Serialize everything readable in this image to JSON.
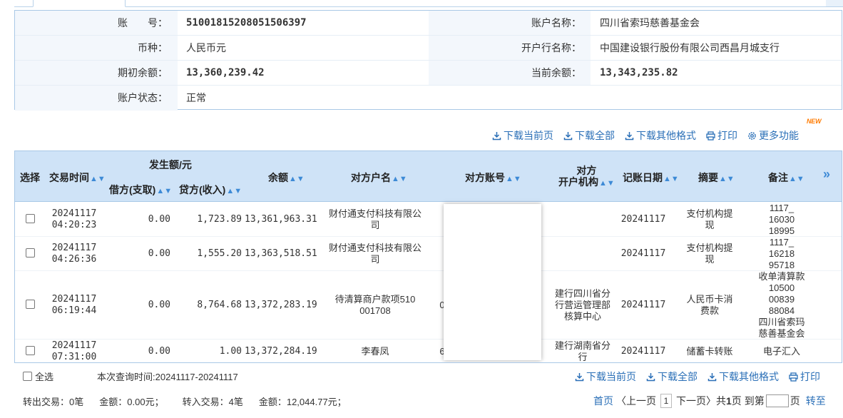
{
  "account": {
    "number_label": "账　　号：",
    "number": "51001815208051506397",
    "name_label": "账户名称：",
    "name": "四川省索玛慈善基金会",
    "currency_label": "币种：",
    "currency": "人民币元",
    "bank_label": "开户行名称：",
    "bank": "中国建设银行股份有限公司西昌月城支行",
    "opening_balance_label": "期初余额：",
    "opening_balance": "13,360,239.42",
    "current_balance_label": "当前余额：",
    "current_balance": "13,343,235.82",
    "status_label": "账户状态：",
    "status": "正常"
  },
  "toolbar": {
    "download_page": "下载当前页",
    "download_all": "下载全部",
    "download_other": "下载其他格式",
    "print": "打印",
    "more": "更多功能",
    "new_badge": "NEW"
  },
  "columns": {
    "select": "选择",
    "time": "交易时间",
    "amount_group": "发生额/元",
    "debit": "借方(支取)",
    "credit": "贷方(收入)",
    "balance": "余额",
    "party_name": "对方户名",
    "party_account": "对方账号",
    "party_bank_1": "对方",
    "party_bank_2": "开户机构",
    "post_date": "记账日期",
    "summary": "摘要",
    "remark": "备注",
    "expand": "»"
  },
  "rows": [
    {
      "date": "20241117",
      "time": "04:20:23",
      "debit": "0.00",
      "credit": "1,723.89",
      "balance": "13,361,963.31",
      "party": [
        "财付通支付科技有限公",
        "司"
      ],
      "party_account": "",
      "bank": [],
      "post_date": "20241117",
      "summary": [
        "支付机构提",
        "现"
      ],
      "remark": [
        "1117_",
        "16030",
        "18995"
      ]
    },
    {
      "date": "20241117",
      "time": "04:26:36",
      "debit": "0.00",
      "credit": "1,555.20",
      "balance": "13,363,518.51",
      "party": [
        "财付通支付科技有限公",
        "司"
      ],
      "party_account": "",
      "bank": [],
      "post_date": "20241117",
      "summary": [
        "支付机构提",
        "现"
      ],
      "remark": [
        "1117_",
        "16218",
        "95718"
      ]
    },
    {
      "date": "20241117",
      "time": "06:19:44",
      "debit": "0.00",
      "credit": "8,764.68",
      "balance": "13,372,283.19",
      "party": [
        "待清算商户款项510",
        "001708"
      ],
      "party_account": "0",
      "bank": [
        "建行四川省分",
        "行营运管理部",
        "核算中心"
      ],
      "post_date": "20241117",
      "summary": [
        "人民币卡消",
        "费款"
      ],
      "remark": [
        "收单清算款",
        "10500",
        "00839",
        "88084",
        "四川省索玛",
        "慈善基金会"
      ]
    },
    {
      "date": "20241117",
      "time": "07:31:00",
      "debit": "0.00",
      "credit": "1.00",
      "balance": "13,372,284.19",
      "party": [
        "李春凤"
      ],
      "party_account": "6",
      "bank": [
        "建行湖南省分",
        "行"
      ],
      "post_date": "20241117",
      "summary": [
        "储蓄卡转账"
      ],
      "remark": [
        "电子汇入"
      ]
    }
  ],
  "footer": {
    "select_all": "全选",
    "query_time": "本次查询时间:20241117-20241117",
    "download_page": "下载当前页",
    "download_all": "下载全部",
    "download_other": "下载其他格式",
    "print": "打印",
    "out_label": "转出交易：",
    "out_count": "0笔",
    "out_amount_label": "金额：",
    "out_amount": "0.00元；",
    "in_label": "转入交易：",
    "in_count": "4笔",
    "in_amount_label": "金额：",
    "in_amount": "12,044.77元；"
  },
  "pager": {
    "first": "首页",
    "prev": "〈上一页",
    "current": "1",
    "next": "下一页〉",
    "total_pre": "共",
    "total": "1",
    "total_post": "页",
    "goto_pre": "到第",
    "goto_post": "页",
    "go": "转至"
  },
  "colors": {
    "link": "#2a6fb7",
    "header_bg": "#cfe3f7",
    "border": "#a9c8e6",
    "badge": "#ff7b00"
  }
}
